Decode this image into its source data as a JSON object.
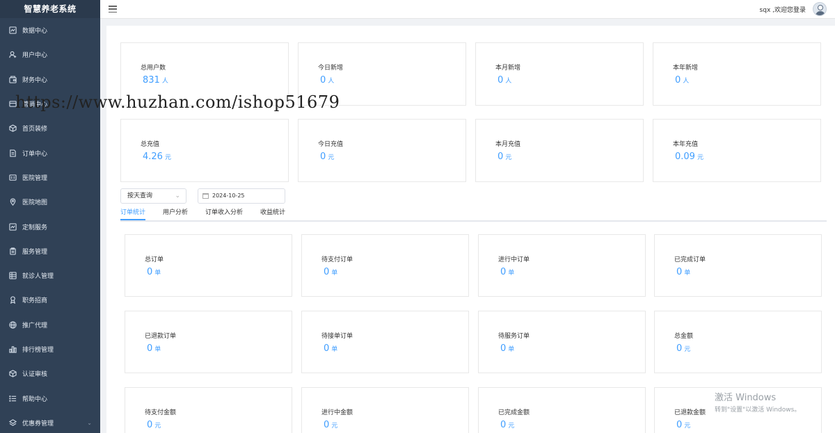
{
  "app": {
    "title": "智慧养老系统"
  },
  "sidebar": {
    "items": [
      {
        "label": "数据中心",
        "icon": "chart-icon"
      },
      {
        "label": "用户中心",
        "icon": "user-icon"
      },
      {
        "label": "财务中心",
        "icon": "wallet-icon"
      },
      {
        "label": "营销中心",
        "icon": "card-icon"
      },
      {
        "label": "首页装修",
        "icon": "cube-icon"
      },
      {
        "label": "订单中心",
        "icon": "document-icon"
      },
      {
        "label": "医院管理",
        "icon": "grid-icon"
      },
      {
        "label": "医院地图",
        "icon": "location-icon"
      },
      {
        "label": "定制服务",
        "icon": "chart-icon"
      },
      {
        "label": "服务管理",
        "icon": "clipboard-icon"
      },
      {
        "label": "就诊人管理",
        "icon": "table-icon"
      },
      {
        "label": "职务招商",
        "icon": "medal-icon"
      },
      {
        "label": "推广代理",
        "icon": "globe-icon"
      },
      {
        "label": "排行榜管理",
        "icon": "bars-icon"
      },
      {
        "label": "认证审核",
        "icon": "cube-icon"
      },
      {
        "label": "帮助中心",
        "icon": "list-icon"
      },
      {
        "label": "优惠券管理",
        "icon": "layers-icon"
      }
    ]
  },
  "header": {
    "welcome": "sqx ,欢迎您登录"
  },
  "summary": [
    {
      "label": "总用户数",
      "value": "831",
      "unit": "人"
    },
    {
      "label": "今日新增",
      "value": "0",
      "unit": "人"
    },
    {
      "label": "本月新增",
      "value": "0",
      "unit": "人"
    },
    {
      "label": "本年新增",
      "value": "0",
      "unit": "人"
    },
    {
      "label": "总充值",
      "value": "4.26",
      "unit": "元"
    },
    {
      "label": "今日充值",
      "value": "0",
      "unit": "元"
    },
    {
      "label": "本月充值",
      "value": "0",
      "unit": "元"
    },
    {
      "label": "本年充值",
      "value": "0.09",
      "unit": "元"
    }
  ],
  "filters": {
    "query_mode": "按天查询",
    "date": "2024-10-25"
  },
  "tabs": [
    "订单统计",
    "用户分析",
    "订单收入分析",
    "收益统计"
  ],
  "orders": [
    {
      "label": "总订单",
      "value": "0",
      "unit": "单"
    },
    {
      "label": "待支付订单",
      "value": "0",
      "unit": "单"
    },
    {
      "label": "进行中订单",
      "value": "0",
      "unit": "单"
    },
    {
      "label": "已完成订单",
      "value": "0",
      "unit": "单"
    },
    {
      "label": "已退款订单",
      "value": "0",
      "unit": "单"
    },
    {
      "label": "待接单订单",
      "value": "0",
      "unit": "单"
    },
    {
      "label": "待服务订单",
      "value": "0",
      "unit": "单"
    },
    {
      "label": "总金额",
      "value": "0",
      "unit": "元"
    },
    {
      "label": "待支付金额",
      "value": "0",
      "unit": "元"
    },
    {
      "label": "进行中金额",
      "value": "0",
      "unit": "元"
    },
    {
      "label": "已完成金额",
      "value": "0",
      "unit": "元"
    },
    {
      "label": "已退款金额",
      "value": "0",
      "unit": "元"
    }
  ],
  "watermark": {
    "url": "https://www.huzhan.com/ishop51679",
    "activate_title": "激活 Windows",
    "activate_hint": "转到\"设置\"以激活 Windows。"
  }
}
